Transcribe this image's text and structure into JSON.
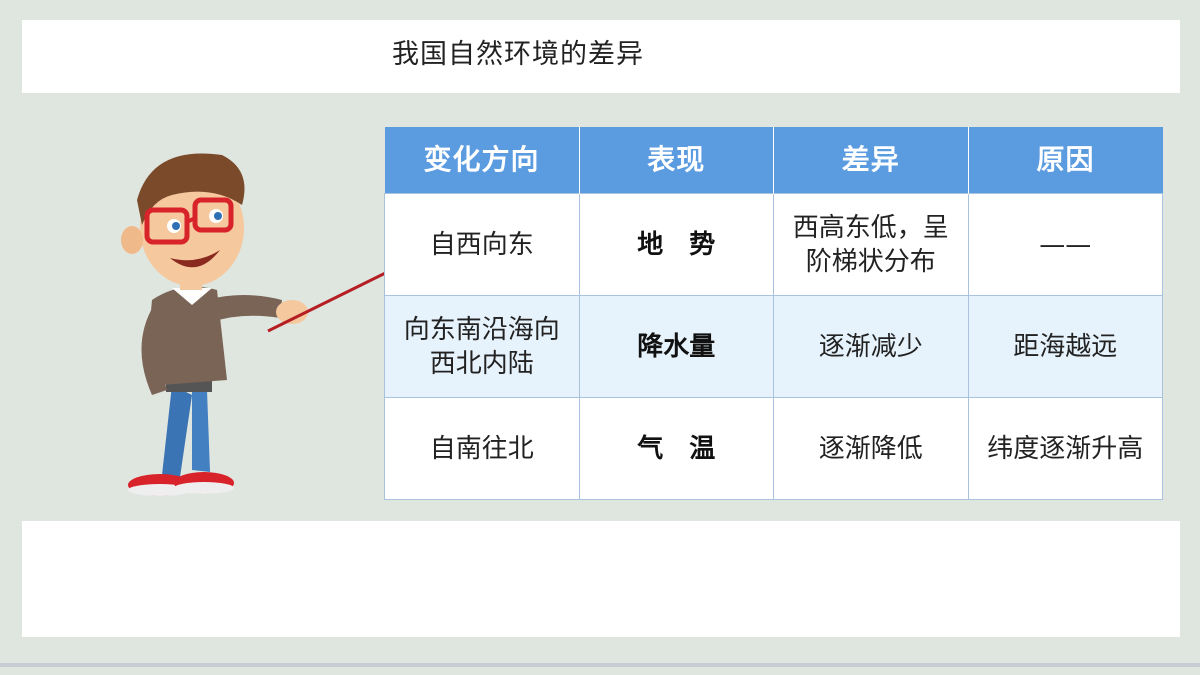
{
  "title": "我国自然环境的差异",
  "table": {
    "headers": [
      "变化方向",
      "表现",
      "差异",
      "原因"
    ],
    "rows": [
      {
        "direction": "自西向东",
        "aspect": "地　势",
        "difference": "西高东低，呈阶梯状分布",
        "reason": "——"
      },
      {
        "direction": "向东南沿海向西北内陆",
        "aspect": "降水量",
        "difference": "逐渐减少",
        "reason": "距海越远"
      },
      {
        "direction": "自南往北",
        "aspect": "气　温",
        "difference": "逐渐降低",
        "reason": "纬度逐渐升高"
      }
    ]
  },
  "illustration": "cartoon-teacher-with-pointer",
  "colors": {
    "header": "#5b9be0",
    "row_alt": "#e7f3fc",
    "background": "#dfe6df"
  }
}
